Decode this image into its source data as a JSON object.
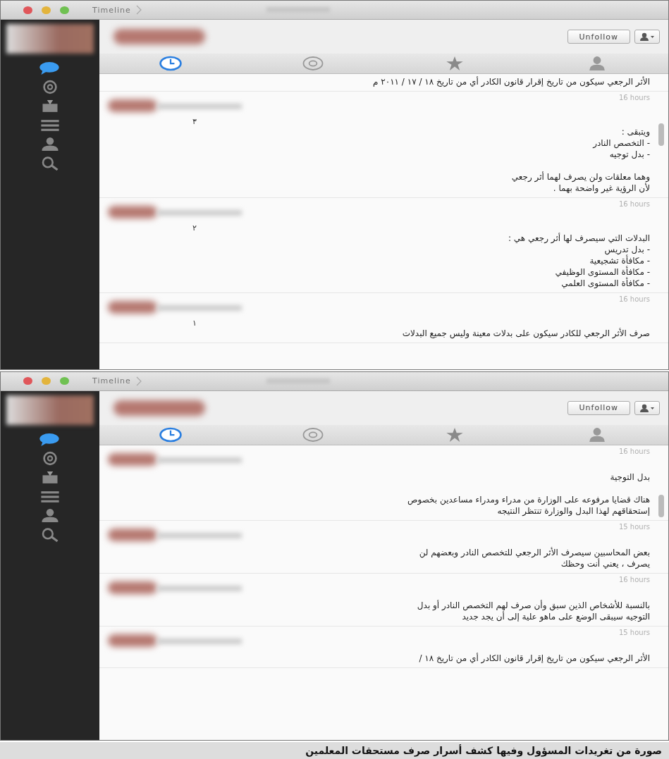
{
  "windows": [
    {
      "title": "Timeline",
      "unfollow_button": "Unfollow",
      "sidebar_items": [
        {
          "kind": "bubble",
          "selected": true
        },
        {
          "kind": "mention",
          "selected": false
        },
        {
          "kind": "inbox",
          "selected": false
        },
        {
          "kind": "list",
          "selected": false
        },
        {
          "kind": "person",
          "selected": false
        },
        {
          "kind": "search",
          "selected": false
        }
      ],
      "tabs": [
        {
          "kind": "clock",
          "selected": true
        },
        {
          "kind": "mention",
          "selected": false
        },
        {
          "kind": "star",
          "selected": false
        },
        {
          "kind": "person",
          "selected": false
        }
      ],
      "top_fragment": "الأثر الرجعي سيكون من تاريخ إقرار قانون الكادر أي من تاريخ ١٨ / ١٧ / ٢٠١١ م",
      "tweets": [
        {
          "time": "16 hours",
          "number": "٣",
          "text": "ويتبقى :\n- التخصص النادر\n- بدل توجيه\n\nوهما معلقات ولن يصرف لهما أثر رجعي\nلأن الرؤية غير واضحة بهما ."
        },
        {
          "time": "16 hours",
          "number": "٢",
          "text": "البدلات التي سيصرف لها أثر رجعي هي :\n- بدل تدريس\n- مكافأة تشجيعية\n- مكافأة المستوى الوظيفي\n- مكافأة المستوى العلمي"
        },
        {
          "time": "16 hours",
          "number": "١",
          "text": "صرف الأثر الرجعي للكادر سيكون على بدلات معينة وليس جميع البدلات"
        }
      ]
    },
    {
      "title": "Timeline",
      "unfollow_button": "Unfollow",
      "sidebar_items": [
        {
          "kind": "bubble",
          "selected": true
        },
        {
          "kind": "mention",
          "selected": false
        },
        {
          "kind": "inbox",
          "selected": false
        },
        {
          "kind": "list",
          "selected": false
        },
        {
          "kind": "person",
          "selected": false
        },
        {
          "kind": "search",
          "selected": false
        }
      ],
      "tabs": [
        {
          "kind": "clock",
          "selected": true
        },
        {
          "kind": "mention",
          "selected": false
        },
        {
          "kind": "star",
          "selected": false
        },
        {
          "kind": "person",
          "selected": false
        }
      ],
      "tweets": [
        {
          "time": "16 hours",
          "text": "بدل التوجية\n\nهناك قضايا مرفوعه على الوزارة من مدراء ومدراء مساعدين بخصوص\nإستحقاقهم لهذا البدل والوزارة تنتظر النتيجه"
        },
        {
          "time": "15 hours",
          "text": "بعض المحاسبين سيصرف الأثر الرجعي للتخصص النادر وبعضهم لن\nيصرف ، يعني أنت وحظك"
        },
        {
          "time": "16 hours",
          "text": "بالنسبة للأشخاص الذين سبق وأن صرف لهم التخصص النادر أو بدل\nالتوجيه سيبقى الوضع على ماهو علية إلى أن يجد جديد"
        },
        {
          "time": "15 hours",
          "text": "الأثر الرجعي سيكون من تاريخ إقرار قانون الكادر أي من تاريخ ١٨ /"
        }
      ]
    }
  ],
  "caption": "صورة من تغريدات المسؤول وفيها كشف أسرار صرف مستحقات المعلمين"
}
